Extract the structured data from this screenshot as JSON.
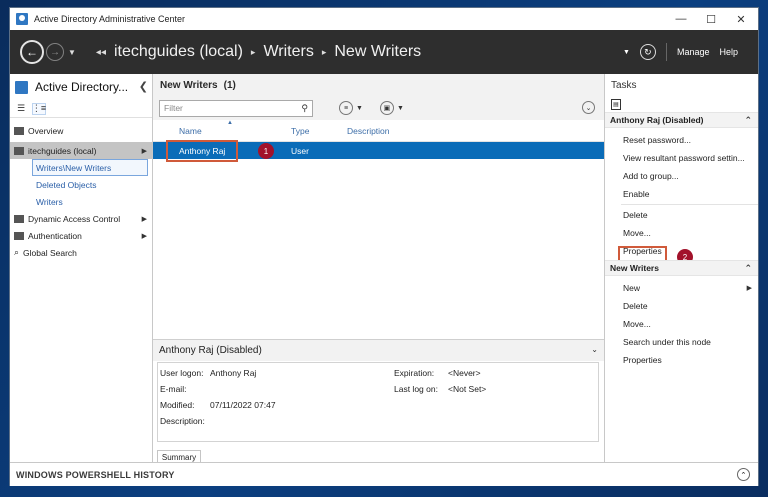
{
  "window": {
    "title": "Active Directory Administrative Center",
    "controls": {
      "minimize": "—",
      "maximize": "☐",
      "close": "✕"
    }
  },
  "navbar": {
    "breadcrumb": [
      "itechguides (local)",
      "Writers",
      "New Writers"
    ],
    "manage_label": "Manage",
    "help_label": "Help"
  },
  "left_pane": {
    "title": "Active Directory...",
    "items": [
      {
        "label": "Overview"
      },
      {
        "label": "itechguides (local)"
      },
      {
        "label": "Writers\\New Writers"
      },
      {
        "label": "Deleted Objects"
      },
      {
        "label": "Writers"
      },
      {
        "label": "Dynamic Access Control"
      },
      {
        "label": "Authentication"
      },
      {
        "label": "Global Search"
      }
    ]
  },
  "center": {
    "header_title": "New Writers",
    "header_count": "(1)",
    "filter_placeholder": "Filter",
    "columns": [
      "Name",
      "Type",
      "Description"
    ],
    "rows": [
      {
        "name": "Anthony Raj",
        "type": "User",
        "description": ""
      }
    ],
    "callout_1": "1"
  },
  "preview": {
    "title": "Anthony Raj (Disabled)",
    "fields": {
      "user_logon_label": "User logon:",
      "user_logon_value": "Anthony Raj",
      "email_label": "E-mail:",
      "modified_label": "Modified:",
      "modified_value": "07/11/2022 07:47",
      "description_label": "Description:",
      "expiration_label": "Expiration:",
      "expiration_value": "<Never>",
      "last_logon_label": "Last log on:",
      "last_logon_value": "<Not Set>"
    },
    "tab_label": "Summary"
  },
  "tasks": {
    "title": "Tasks",
    "section_1": "Anthony Raj (Disabled)",
    "section_1_items": [
      "Reset password...",
      "View resultant password settin...",
      "Add to group...",
      "Enable",
      "Delete",
      "Move...",
      "Properties"
    ],
    "callout_2": "2",
    "section_2": "New Writers",
    "section_2_items": [
      "New",
      "Delete",
      "Move...",
      "Search under this node",
      "Properties"
    ]
  },
  "bottom": {
    "label": "WINDOWS POWERSHELL HISTORY"
  },
  "colors": {
    "selected_row": "#0a6cb8",
    "callout": "#d05a3a",
    "badge": "#a2122b",
    "navbar": "#2e2e2e"
  }
}
